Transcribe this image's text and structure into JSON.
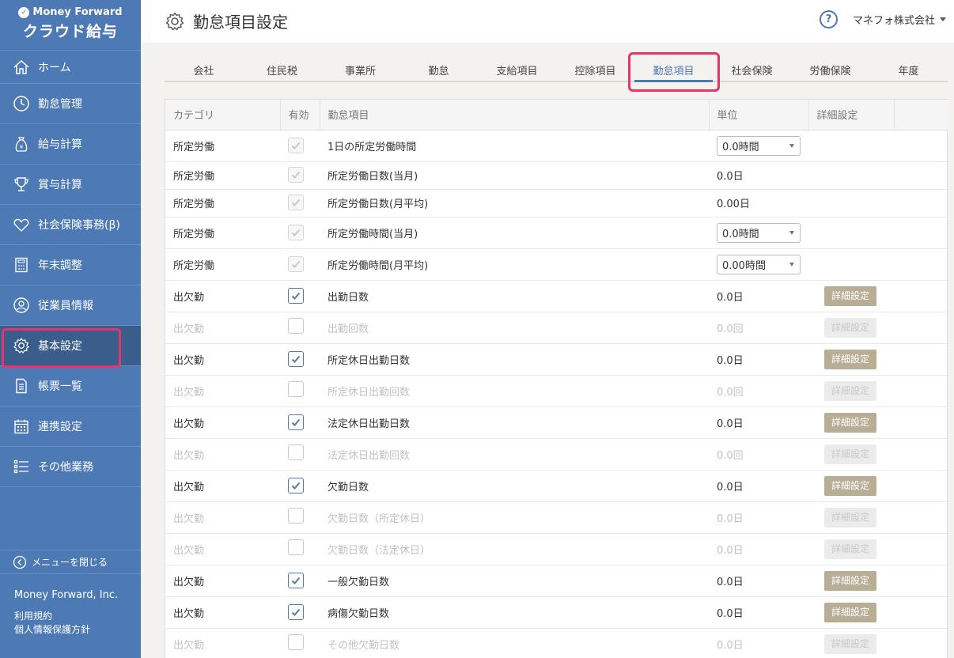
{
  "app": {
    "brand": "Money Forward",
    "product": "クラウド給与"
  },
  "sidebar": {
    "items": [
      {
        "label": "ホーム",
        "icon": "home-icon"
      },
      {
        "label": "勤怠管理",
        "icon": "clock-icon"
      },
      {
        "label": "給与計算",
        "icon": "money-bag-icon"
      },
      {
        "label": "賞与計算",
        "icon": "trophy-icon"
      },
      {
        "label": "社会保険事務(β)",
        "icon": "heart-icon"
      },
      {
        "label": "年末調整",
        "icon": "calculator-icon"
      },
      {
        "label": "従業員情報",
        "icon": "person-icon"
      },
      {
        "label": "基本設定",
        "icon": "gear-icon",
        "active": true
      },
      {
        "label": "帳票一覧",
        "icon": "document-icon"
      },
      {
        "label": "連携設定",
        "icon": "calendar-icon"
      },
      {
        "label": "その他業務",
        "icon": "list-icon"
      }
    ],
    "close_menu": "メニューを閉じる",
    "company": "Money Forward, Inc.",
    "terms": "利用規約",
    "privacy": "個人情報保護方針"
  },
  "header": {
    "title": "勤怠項目設定",
    "help": "?",
    "company_name": "マネフォ株式会社"
  },
  "tabs": [
    {
      "label": "会社"
    },
    {
      "label": "住民税"
    },
    {
      "label": "事業所"
    },
    {
      "label": "勤怠"
    },
    {
      "label": "支給項目"
    },
    {
      "label": "控除項目"
    },
    {
      "label": "勤怠項目",
      "active": true
    },
    {
      "label": "社会保険"
    },
    {
      "label": "労働保険"
    },
    {
      "label": "年度"
    }
  ],
  "table": {
    "headers": {
      "category": "カテゴリ",
      "enabled": "有効",
      "item": "勤怠項目",
      "unit": "単位",
      "detail": "詳細設定"
    },
    "detail_button": "詳細設定",
    "rows": [
      {
        "category": "所定労働",
        "enabled": "locked",
        "item": "1日の所定労働時間",
        "unit": "0.0時間",
        "unit_select": true,
        "detail": false,
        "disabled": false
      },
      {
        "category": "所定労働",
        "enabled": "locked",
        "item": "所定労働日数(当月)",
        "unit": "0.0日",
        "unit_select": false,
        "detail": false,
        "disabled": false
      },
      {
        "category": "所定労働",
        "enabled": "locked",
        "item": "所定労働日数(月平均)",
        "unit": "0.00日",
        "unit_select": false,
        "detail": false,
        "disabled": false
      },
      {
        "category": "所定労働",
        "enabled": "locked",
        "item": "所定労働時間(当月)",
        "unit": "0.0時間",
        "unit_select": true,
        "detail": false,
        "disabled": false
      },
      {
        "category": "所定労働",
        "enabled": "locked",
        "item": "所定労働時間(月平均)",
        "unit": "0.00時間",
        "unit_select": true,
        "detail": false,
        "disabled": false
      },
      {
        "category": "出欠勤",
        "enabled": "on",
        "item": "出勤日数",
        "unit": "0.0日",
        "unit_select": false,
        "detail": true,
        "disabled": false
      },
      {
        "category": "出欠勤",
        "enabled": "off",
        "item": "出勤回数",
        "unit": "0.0回",
        "unit_select": false,
        "detail": true,
        "disabled": true
      },
      {
        "category": "出欠勤",
        "enabled": "on",
        "item": "所定休日出勤日数",
        "unit": "0.0日",
        "unit_select": false,
        "detail": true,
        "disabled": false
      },
      {
        "category": "出欠勤",
        "enabled": "off",
        "item": "所定休日出勤回数",
        "unit": "0.0回",
        "unit_select": false,
        "detail": true,
        "disabled": true
      },
      {
        "category": "出欠勤",
        "enabled": "on",
        "item": "法定休日出勤日数",
        "unit": "0.0日",
        "unit_select": false,
        "detail": true,
        "disabled": false
      },
      {
        "category": "出欠勤",
        "enabled": "off",
        "item": "法定休日出勤回数",
        "unit": "0.0回",
        "unit_select": false,
        "detail": true,
        "disabled": true
      },
      {
        "category": "出欠勤",
        "enabled": "on",
        "item": "欠勤日数",
        "unit": "0.0日",
        "unit_select": false,
        "detail": true,
        "disabled": false
      },
      {
        "category": "出欠勤",
        "enabled": "off",
        "item": "欠勤日数（所定休日）",
        "unit": "0.0日",
        "unit_select": false,
        "detail": true,
        "disabled": true
      },
      {
        "category": "出欠勤",
        "enabled": "off",
        "item": "欠勤日数（法定休日）",
        "unit": "0.0日",
        "unit_select": false,
        "detail": true,
        "disabled": true
      },
      {
        "category": "出欠勤",
        "enabled": "on",
        "item": "一般欠勤日数",
        "unit": "0.0日",
        "unit_select": false,
        "detail": true,
        "disabled": false
      },
      {
        "category": "出欠勤",
        "enabled": "on",
        "item": "病傷欠勤日数",
        "unit": "0.0日",
        "unit_select": false,
        "detail": true,
        "disabled": false
      },
      {
        "category": "出欠勤",
        "enabled": "off",
        "item": "その他欠勤日数",
        "unit": "0.0日",
        "unit_select": false,
        "detail": true,
        "disabled": true
      }
    ]
  },
  "colors": {
    "sidebar": "#4d79b4",
    "accent": "#4d79b4",
    "highlight": "#e8336d",
    "detail_button": "#b8ae96"
  }
}
